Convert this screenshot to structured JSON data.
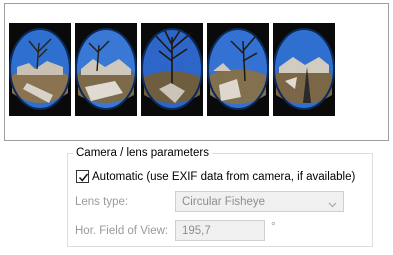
{
  "preview": {
    "thumbnails": [
      {
        "name": "fisheye-thumb-1"
      },
      {
        "name": "fisheye-thumb-2"
      },
      {
        "name": "fisheye-thumb-3"
      },
      {
        "name": "fisheye-thumb-4"
      },
      {
        "name": "fisheye-thumb-5"
      }
    ]
  },
  "camera_group": {
    "title": "Camera / lens parameters",
    "automatic": {
      "label": "Automatic (use EXIF data from camera, if available)",
      "checked": true
    },
    "lens_type": {
      "label": "Lens type:",
      "value": "Circular Fisheye",
      "enabled": false
    },
    "fov": {
      "label": "Hor. Field of View:",
      "value": "195,7",
      "unit": "°",
      "enabled": false
    }
  },
  "colors": {
    "disabled_text": "#9a9a9a",
    "group_border": "#dcdcdc",
    "sky": "#2f6fd0"
  }
}
